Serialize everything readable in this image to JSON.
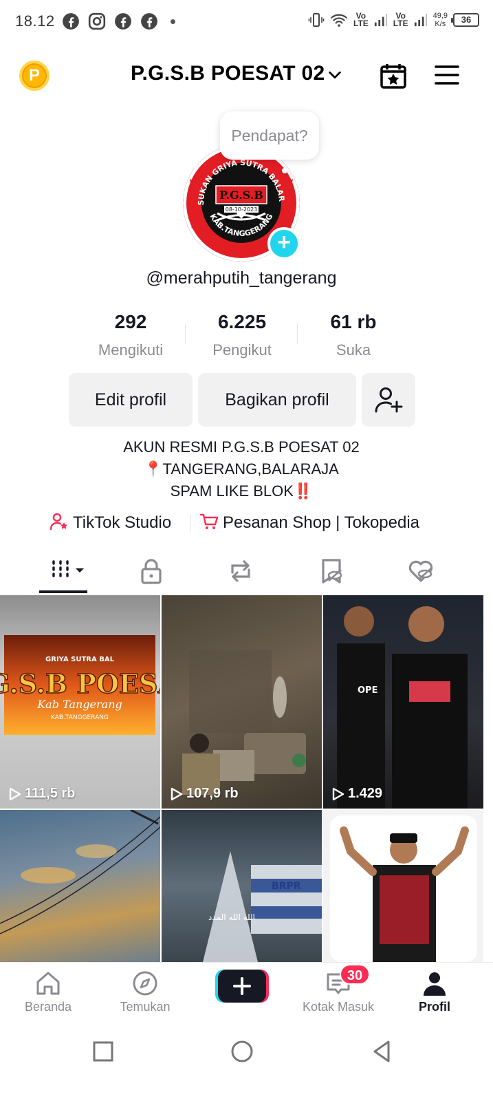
{
  "status_bar": {
    "time": "18.12",
    "lte1": "Vo\nLTE",
    "lte2": "Vo\nLTE",
    "speed": "49,9\nK/s",
    "battery": "36"
  },
  "header": {
    "account_name": "P.G.S.B POESAT 02"
  },
  "profile": {
    "bubble_text": "Pendapat?",
    "handle": "@merahputih_tangerang",
    "logo_top": "PASUKAN GRIYA SUTRA BALARAJA",
    "logo_center": "P.G.S.B",
    "logo_date": "08-10-2023",
    "logo_bottom": "KAB.TANGGERANG"
  },
  "stats": [
    {
      "value": "292",
      "label": "Mengikuti"
    },
    {
      "value": "6.225",
      "label": "Pengikut"
    },
    {
      "value": "61 rb",
      "label": "Suka"
    }
  ],
  "buttons": {
    "edit": "Edit profil",
    "share": "Bagikan profil"
  },
  "bio": {
    "line1": "AKUN RESMI P.G.S.B POESAT 02",
    "line2": "📍TANGERANG,BALARAJA",
    "line3": "SPAM LIKE BLOK‼️"
  },
  "links": {
    "studio": "TikTok Studio",
    "shop": "Pesanan Shop | Tokopedia"
  },
  "videos": [
    {
      "views": "111,5 rb",
      "overlay_top": "GRIYA SUTRA BAL",
      "overlay_main": "P.G.S.B POESAT",
      "overlay_script": "Kab Tangerang",
      "overlay_bottom": "KAB.TANGGERANG"
    },
    {
      "views": "107,9 rb"
    },
    {
      "views": "1.429",
      "shirt": "OPE"
    },
    {
      "views": ""
    },
    {
      "views": "",
      "caption": "الله الله المدد",
      "flag": "BRPR"
    },
    {
      "views": ""
    }
  ],
  "bottom_nav": {
    "home": "Beranda",
    "discover": "Temukan",
    "inbox": "Kotak Masuk",
    "inbox_badge": "30",
    "profile": "Profil"
  },
  "colors": {
    "accent_pink": "#fe2c55",
    "accent_cyan": "#20d5ec",
    "text": "#161823",
    "muted": "#8a8b91"
  }
}
